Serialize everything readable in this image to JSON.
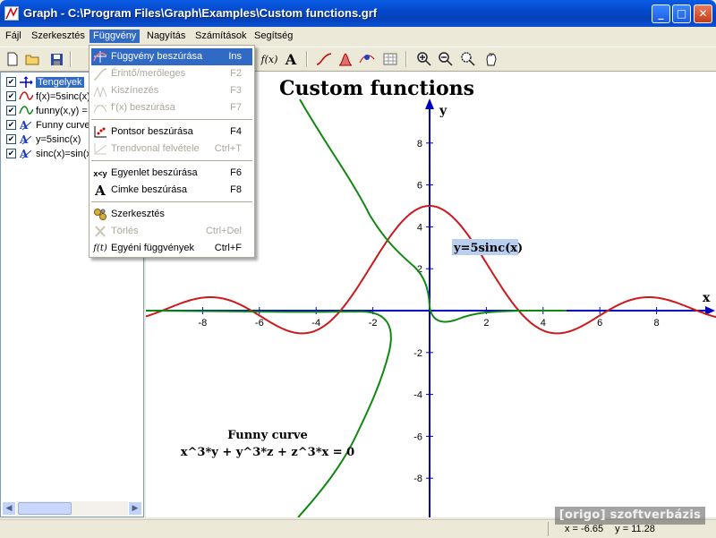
{
  "window": {
    "title": "Graph - C:\\Program Files\\Graph\\Examples\\Custom functions.grf",
    "min": "_",
    "max": "□",
    "close": "✕"
  },
  "menubar": {
    "items": [
      "Fájl",
      "Szerkesztés",
      "Függvény",
      "Nagyítás",
      "Számítások",
      "Segítség"
    ],
    "active": "Függvény"
  },
  "toolbar": {
    "fx_label": "f(x)",
    "text_label": "A",
    "icons": [
      "new-icon",
      "open-icon",
      "save-icon",
      "function-icon",
      "text-icon",
      "tangent-icon",
      "shade-icon",
      "point-icon",
      "table-icon",
      "zoom-in-icon",
      "zoom-out-icon",
      "zoom-window-icon",
      "pan-icon"
    ]
  },
  "function_menu": {
    "items": [
      {
        "label": "Függvény beszúrása",
        "shortcut": "Ins",
        "enabled": true,
        "highlighted": true,
        "icon": "insert-function-icon"
      },
      {
        "label": "Érintő/merőleges",
        "shortcut": "F2",
        "enabled": false,
        "icon": "tangent-icon"
      },
      {
        "label": "Kiszínezés",
        "shortcut": "F3",
        "enabled": false,
        "icon": "shading-icon"
      },
      {
        "label": "f'(x) beszúrása",
        "shortcut": "F7",
        "enabled": false,
        "icon": "derivative-icon"
      },
      {
        "label": "Pontsor beszúrása",
        "shortcut": "F4",
        "enabled": true,
        "icon": "point-series-icon"
      },
      {
        "label": "Trendvonal felvétele",
        "shortcut": "Ctrl+T",
        "enabled": false,
        "icon": "trendline-icon"
      },
      {
        "label": "Egyenlet beszúrása",
        "shortcut": "F6",
        "enabled": true,
        "icon": "equation-icon"
      },
      {
        "label": "Cimke beszúrása",
        "shortcut": "F8",
        "enabled": true,
        "icon": "label-icon"
      },
      {
        "label": "Szerkesztés",
        "shortcut": "",
        "enabled": true,
        "icon": "edit-icon"
      },
      {
        "label": "Törlés",
        "shortcut": "Ctrl+Del",
        "enabled": false,
        "icon": "delete-icon"
      },
      {
        "label": "Egyéni függvények",
        "shortcut": "Ctrl+F",
        "enabled": true,
        "icon": "custom-functions-icon"
      }
    ],
    "icon_glyphs": {
      "equation": "x<y",
      "custom": "f(t)"
    }
  },
  "sidebar": {
    "items": [
      {
        "label": "Tengelyek",
        "checked": true,
        "selected": true,
        "icon": "axes-icon"
      },
      {
        "label": "f(x)=5sinc(x)",
        "checked": true,
        "icon": "red-curve-icon"
      },
      {
        "label": "funny(x,y) = 0",
        "checked": true,
        "icon": "green-curve-icon"
      },
      {
        "label": "Funny curve",
        "checked": true,
        "icon": "text-label-icon"
      },
      {
        "label": "y=5sinc(x)",
        "checked": true,
        "icon": "text-label-icon"
      },
      {
        "label": "sinc(x)=sin(x)/x",
        "checked": true,
        "icon": "text-label-icon"
      }
    ]
  },
  "graph": {
    "title": "Custom functions",
    "x_axis_label": "x",
    "y_axis_label": "y",
    "x_ticks": [
      "-8",
      "-6",
      "-4",
      "-2",
      "2",
      "4",
      "6",
      "8"
    ],
    "y_ticks": [
      "8",
      "6",
      "4",
      "2",
      "-2",
      "-4",
      "-6",
      "-8"
    ],
    "callout_label": "y=5sinc(x)",
    "annotation_title": "Funny curve",
    "annotation_equation": "x^3*y + y^3*z + z^3*x = 0",
    "colors": {
      "axis": "#0000c0",
      "sinc_curve": "#cc1a1a",
      "funny_curve": "#118811",
      "label_bg": "#b8cff0"
    }
  },
  "status": {
    "x_value": "x = -6.65",
    "y_value": "y = 11.28"
  },
  "watermark": "[origo] szoftverbázis"
}
